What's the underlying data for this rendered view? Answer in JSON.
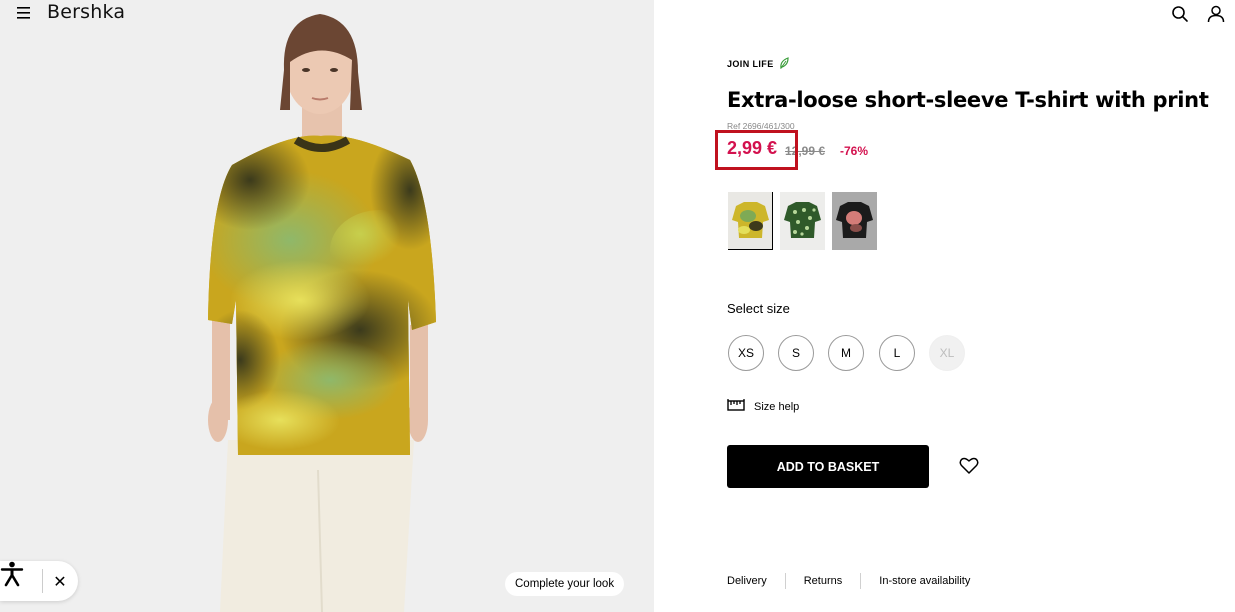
{
  "header": {
    "brand": "Bershka",
    "menu_icon": "hamburger-menu-icon",
    "search_icon": "search-icon",
    "account_icon": "user-icon"
  },
  "gallery": {
    "complete_look_label": "Complete your look"
  },
  "accessibility_widget": {
    "person_icon": "accessibility-icon",
    "close_label": "✕"
  },
  "product": {
    "badge": "JOIN LIFE",
    "badge_icon": "leaf-icon",
    "title": "Extra-loose short-sleeve T-shirt with print",
    "ref": "Ref 2696/461/300",
    "price_current": "2,99 €",
    "price_original": "12,99 €",
    "discount": "-76%",
    "colors": [
      {
        "name": "yellow-green print",
        "selected": true
      },
      {
        "name": "green print",
        "selected": false
      },
      {
        "name": "black print",
        "selected": false
      }
    ],
    "accent_color": "#d3114e",
    "highlight_color": "#c0111f"
  },
  "sizes": {
    "label": "Select size",
    "options": [
      {
        "label": "XS",
        "available": true
      },
      {
        "label": "S",
        "available": true
      },
      {
        "label": "M",
        "available": true
      },
      {
        "label": "L",
        "available": true
      },
      {
        "label": "XL",
        "available": false
      }
    ],
    "help_label": "Size help",
    "help_icon": "ruler-icon"
  },
  "actions": {
    "add_to_basket": "ADD TO BASKET",
    "wishlist_icon": "heart-icon"
  },
  "footer_links": [
    "Delivery",
    "Returns",
    "In-store availability"
  ]
}
